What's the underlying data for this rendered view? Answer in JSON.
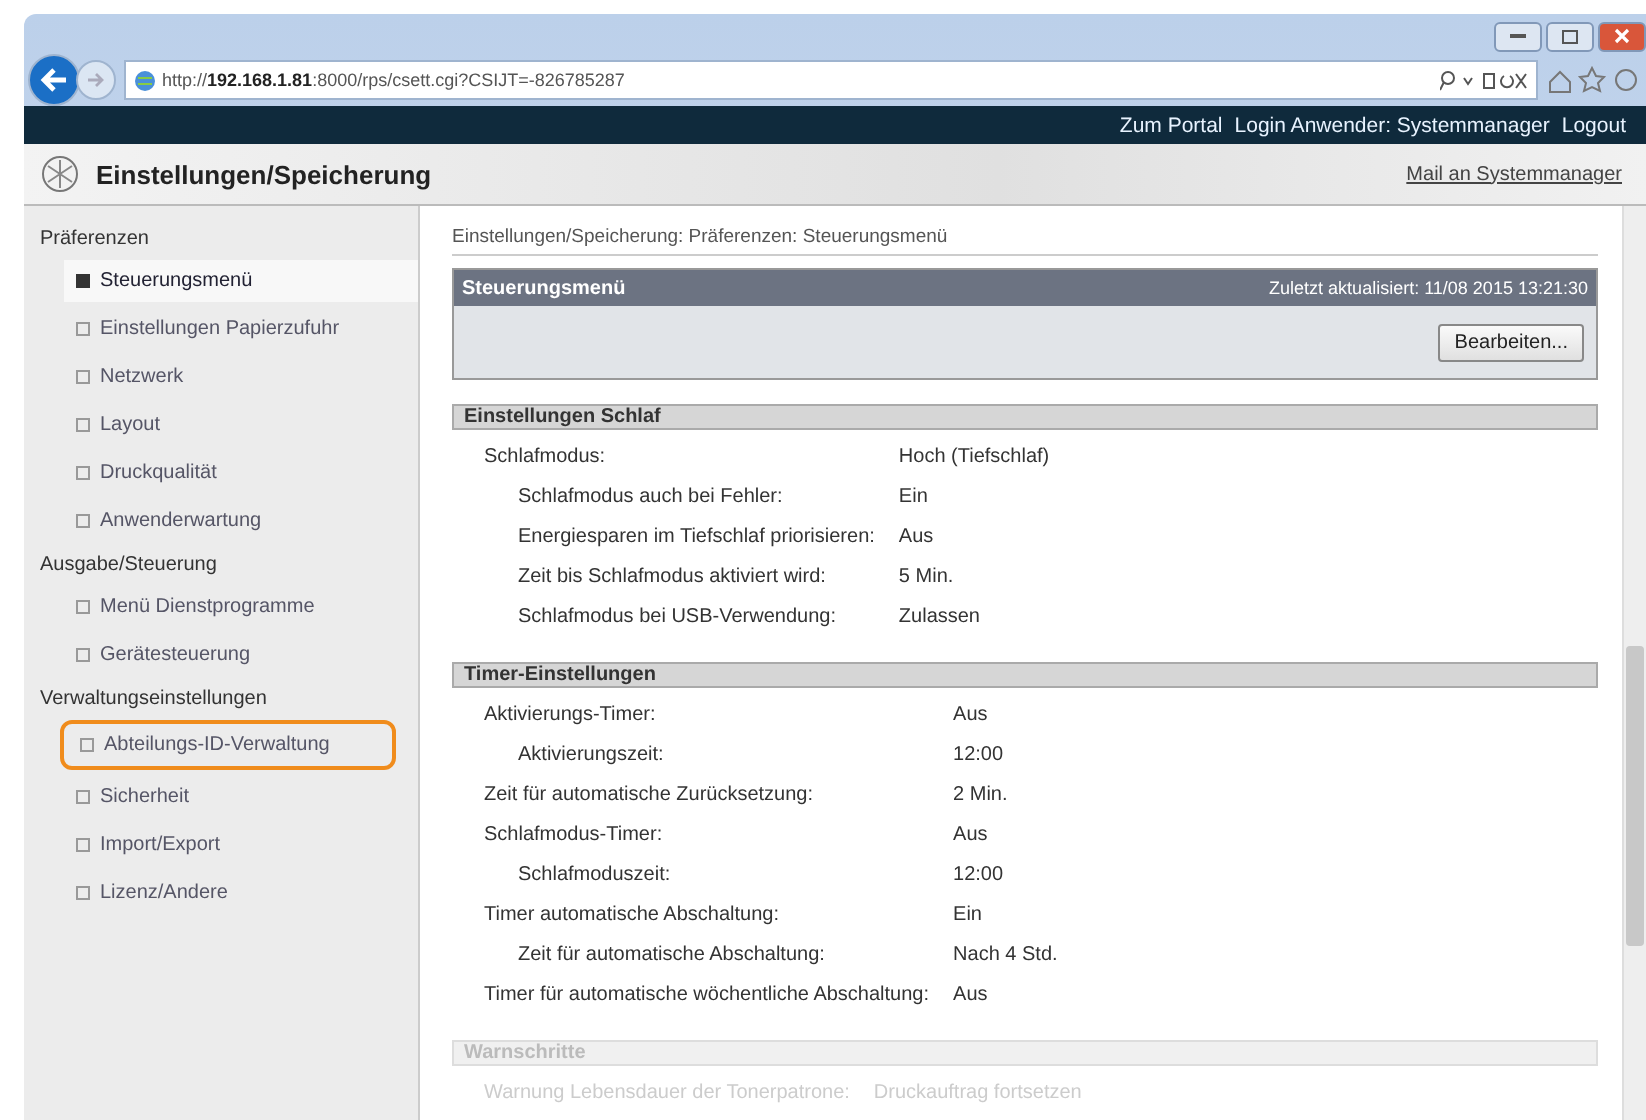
{
  "browser": {
    "url_prefix": "http://",
    "url_host": "192.168.1.81",
    "url_rest": ":8000/rps/csett.cgi?CSIJT=-826785287"
  },
  "header": {
    "links": [
      "Zum Portal",
      "Login Anwender: Systemmanager",
      "Logout"
    ],
    "title": "Einstellungen/Speicherung",
    "mail_link": "Mail an Systemmanager"
  },
  "sidebar": [
    {
      "heading": "Präferenzen",
      "items": [
        {
          "label": "Steuerungsmenü",
          "selected": true,
          "highlighted": false
        },
        {
          "label": "Einstellungen Papierzufuhr",
          "selected": false,
          "highlighted": false
        },
        {
          "label": "Netzwerk",
          "selected": false,
          "highlighted": false
        },
        {
          "label": "Layout",
          "selected": false,
          "highlighted": false
        },
        {
          "label": "Druckqualität",
          "selected": false,
          "highlighted": false
        },
        {
          "label": "Anwenderwartung",
          "selected": false,
          "highlighted": false
        }
      ]
    },
    {
      "heading": "Ausgabe/Steuerung",
      "items": [
        {
          "label": "Menü Dienstprogramme",
          "selected": false,
          "highlighted": false
        },
        {
          "label": "Gerätesteuerung",
          "selected": false,
          "highlighted": false
        }
      ]
    },
    {
      "heading": "Verwaltungseinstellungen",
      "items": [
        {
          "label": "Abteilungs-ID-Verwaltung",
          "selected": false,
          "highlighted": true
        },
        {
          "label": "Sicherheit",
          "selected": false,
          "highlighted": false
        },
        {
          "label": "Import/Export",
          "selected": false,
          "highlighted": false
        },
        {
          "label": "Lizenz/Andere",
          "selected": false,
          "highlighted": false
        }
      ]
    }
  ],
  "breadcrumb": "Einstellungen/Speicherung: Präferenzen: Steuerungsmenü",
  "panel": {
    "title": "Steuerungsmenü",
    "updated": "Zuletzt aktualisiert: 11/08 2015 13:21:30",
    "button": "Bearbeiten..."
  },
  "sections": [
    {
      "title": "Einstellungen Schlaf",
      "faded": false,
      "rows": [
        {
          "label": "Schlafmodus:",
          "value": "Hoch (Tiefschlaf)",
          "children": [
            {
              "label": "Schlafmodus auch bei Fehler:",
              "value": "Ein"
            },
            {
              "label": "Energiesparen im Tiefschlaf priorisieren:",
              "value": "Aus"
            },
            {
              "label": "Zeit bis Schlafmodus aktiviert wird:",
              "value": "5 Min."
            },
            {
              "label": "Schlafmodus bei USB-Verwendung:",
              "value": "Zulassen"
            }
          ]
        }
      ]
    },
    {
      "title": "Timer-Einstellungen",
      "faded": false,
      "rows": [
        {
          "label": "Aktivierungs-Timer:",
          "value": "Aus",
          "children": [
            {
              "label": "Aktivierungszeit:",
              "value": "12:00"
            }
          ]
        },
        {
          "label": "Zeit für automatische Zurücksetzung:",
          "value": "2 Min."
        },
        {
          "label": "Schlafmodus-Timer:",
          "value": "Aus",
          "children": [
            {
              "label": "Schlafmoduszeit:",
              "value": "12:00"
            }
          ]
        },
        {
          "label": "Timer automatische Abschaltung:",
          "value": "Ein",
          "children": [
            {
              "label": "Zeit für automatische Abschaltung:",
              "value": "Nach 4 Std."
            }
          ]
        },
        {
          "label": "Timer für automatische wöchentliche Abschaltung:",
          "value": "Aus"
        }
      ]
    },
    {
      "title": "Warnschritte",
      "faded": true,
      "rows": [
        {
          "label": "Warnung Lebensdauer der Tonerpatrone:",
          "value": "Druckauftrag fortsetzen"
        }
      ]
    }
  ]
}
